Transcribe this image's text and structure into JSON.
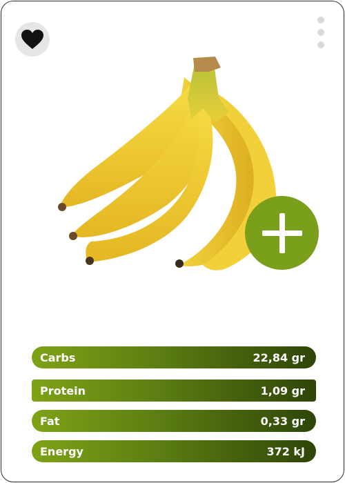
{
  "card": {
    "favorite_icon": "heart-icon",
    "more_icon": "vertical-dots-icon",
    "add_icon": "plus-icon",
    "product_image": "banana-bunch",
    "product_name": "",
    "product_subtitle": ""
  },
  "colors": {
    "accent_green": "#799f1b",
    "bar_gradient_start": "#7ea316",
    "bar_gradient_end": "#2e4508",
    "favorite_bg": "#e6e6e6"
  },
  "nutrition": [
    {
      "label": "Carbs",
      "value": "22,84 gr"
    },
    {
      "label": "Protein",
      "value": "1,09 gr"
    },
    {
      "label": "Fat",
      "value": "0,33 gr"
    },
    {
      "label": "Energy",
      "value": "372 kJ"
    }
  ]
}
